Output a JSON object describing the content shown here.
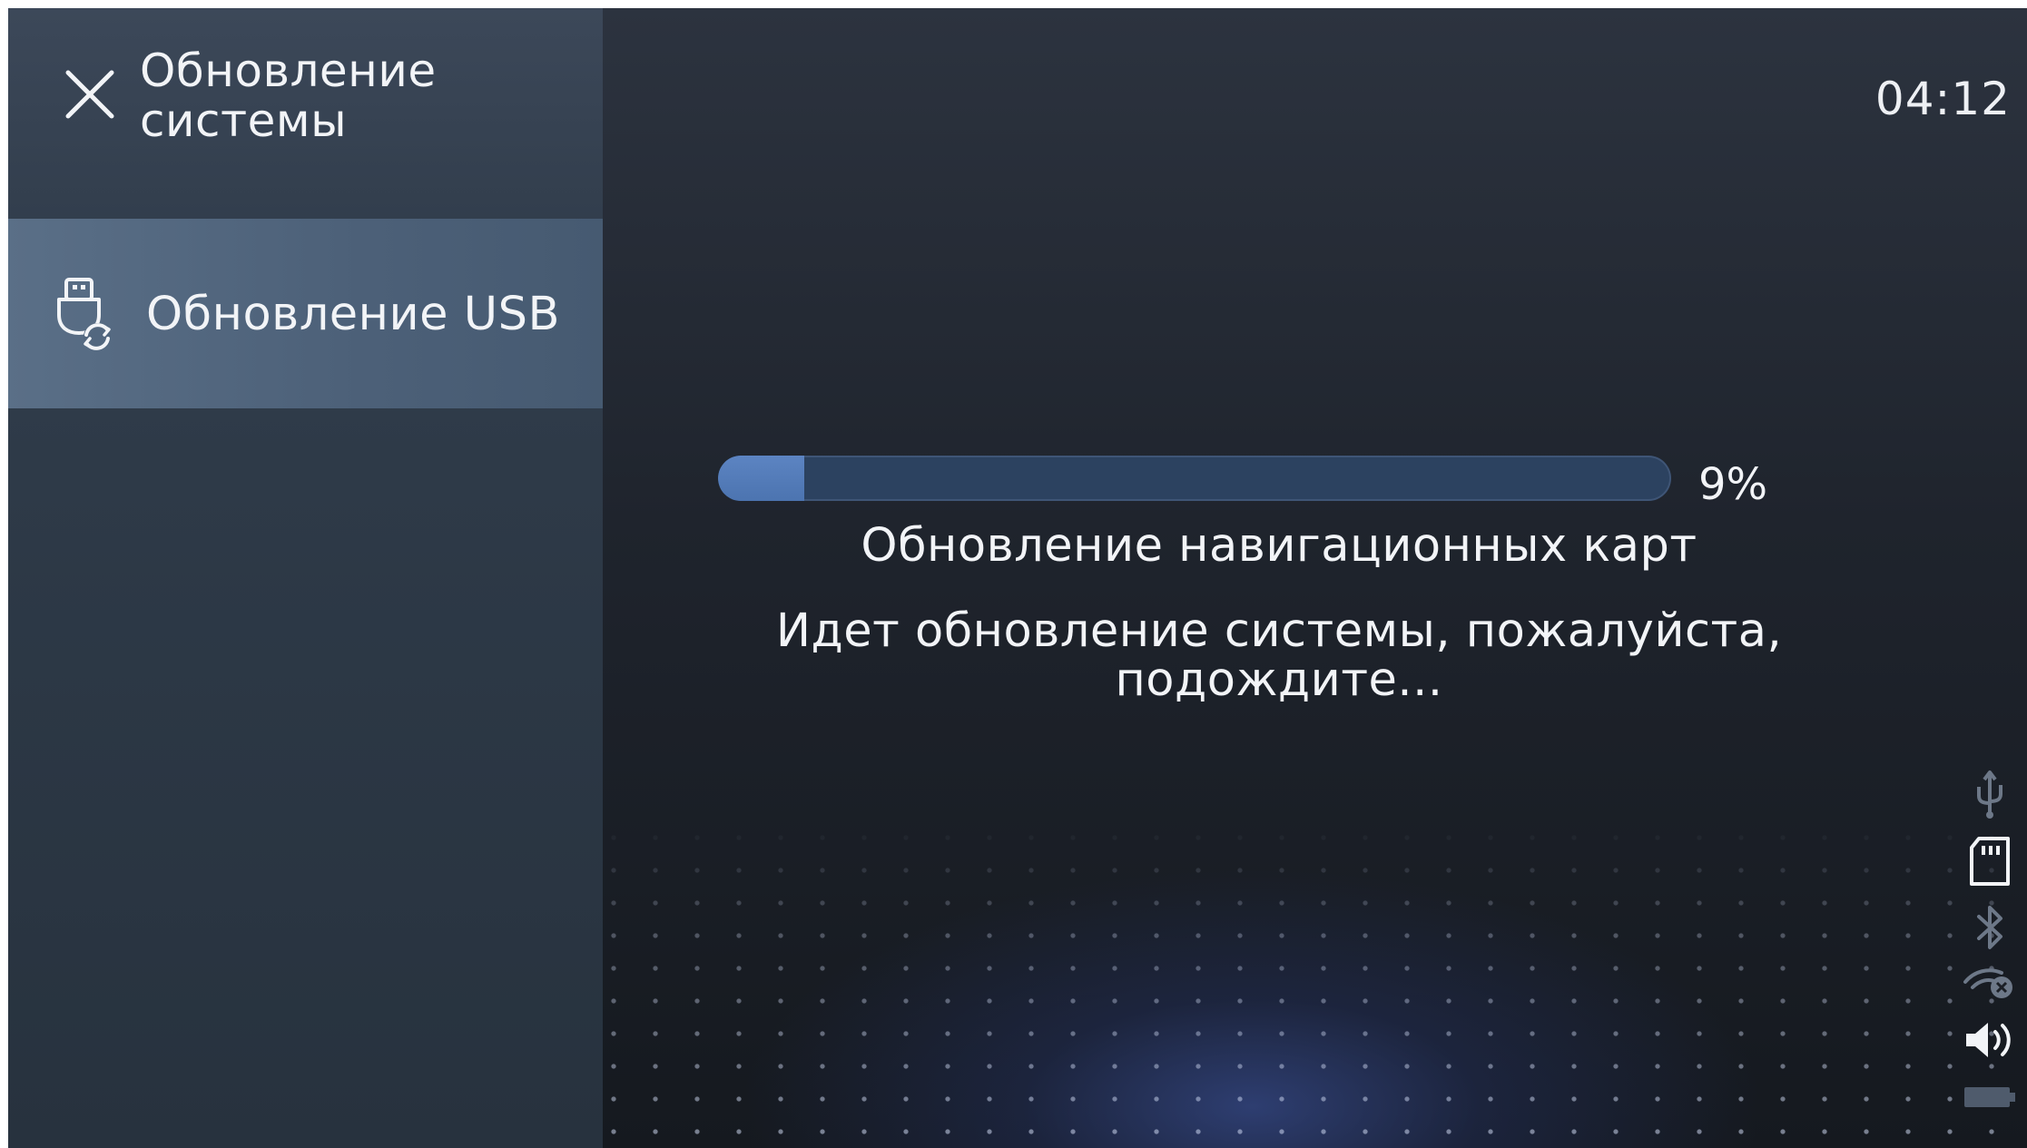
{
  "sidebar": {
    "title": "Обновление системы",
    "close_icon": "close-icon",
    "items": [
      {
        "label": "Обновление USB",
        "icon": "usb-refresh-icon",
        "selected": true
      }
    ]
  },
  "header": {
    "clock": "04:12"
  },
  "update": {
    "progress": 0.09,
    "percent_label": "9%",
    "title": "Обновление навигационных карт",
    "message": "Идет обновление системы, пожалуйста, подождите..."
  },
  "status_bar": {
    "icons": [
      "usb-icon",
      "sd-card-icon",
      "bluetooth-icon",
      "connection-off-icon",
      "volume-icon",
      "battery-icon"
    ]
  },
  "colors": {
    "accent": "#5c84c2",
    "track": "#2c4260",
    "selected_item": "#52677f"
  }
}
